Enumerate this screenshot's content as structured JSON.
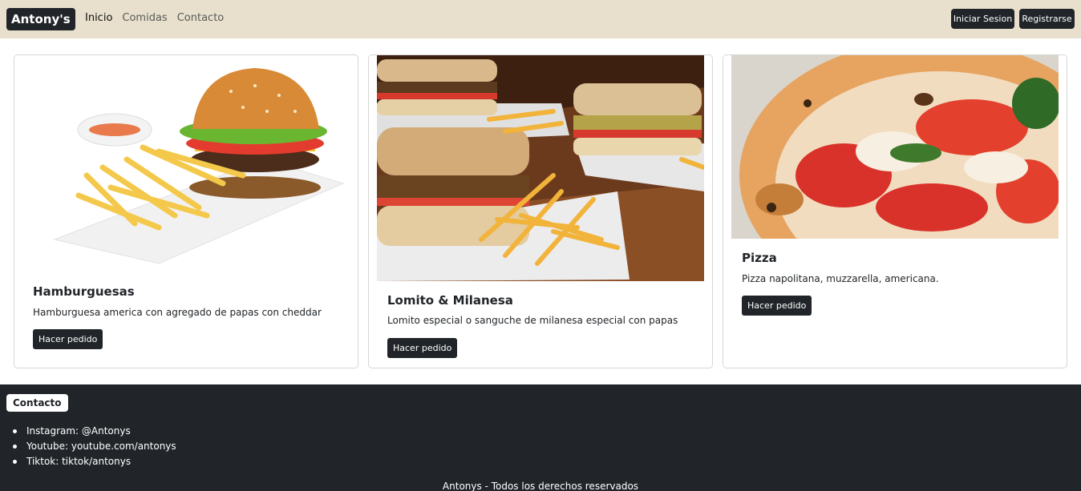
{
  "navbar": {
    "brand": "Antony's",
    "links": [
      "Inicio",
      "Comidas",
      "Contacto"
    ],
    "login_label": "Iniciar Sesion",
    "register_label": "Registrarse"
  },
  "cards": [
    {
      "title": "Hamburguesas",
      "text": "Hamburguesa america con agregado de papas con cheddar",
      "button": "Hacer pedido",
      "image": "burger-and-fries-photo"
    },
    {
      "title": "Lomito & Milanesa",
      "text": "Lomito especial o sanguche de milanesa especial con papas",
      "button": "Hacer pedido",
      "image": "sandwiches-and-fries-photo"
    },
    {
      "title": "Pizza",
      "text": "Pizza napolitana, muzzarella, americana.",
      "button": "Hacer pedido",
      "image": "pizza-photo"
    }
  ],
  "footer": {
    "heading": "Contacto",
    "items": [
      "Instagram: @Antonys",
      "Youtube: youtube.com/antonys",
      "Tiktok: tiktok/antonys"
    ],
    "copyright": "Antonys - Todos los derechos reservados"
  },
  "colors": {
    "navbar_bg": "#e8e0cc",
    "dark": "#212529",
    "footer_bg": "#212529"
  }
}
